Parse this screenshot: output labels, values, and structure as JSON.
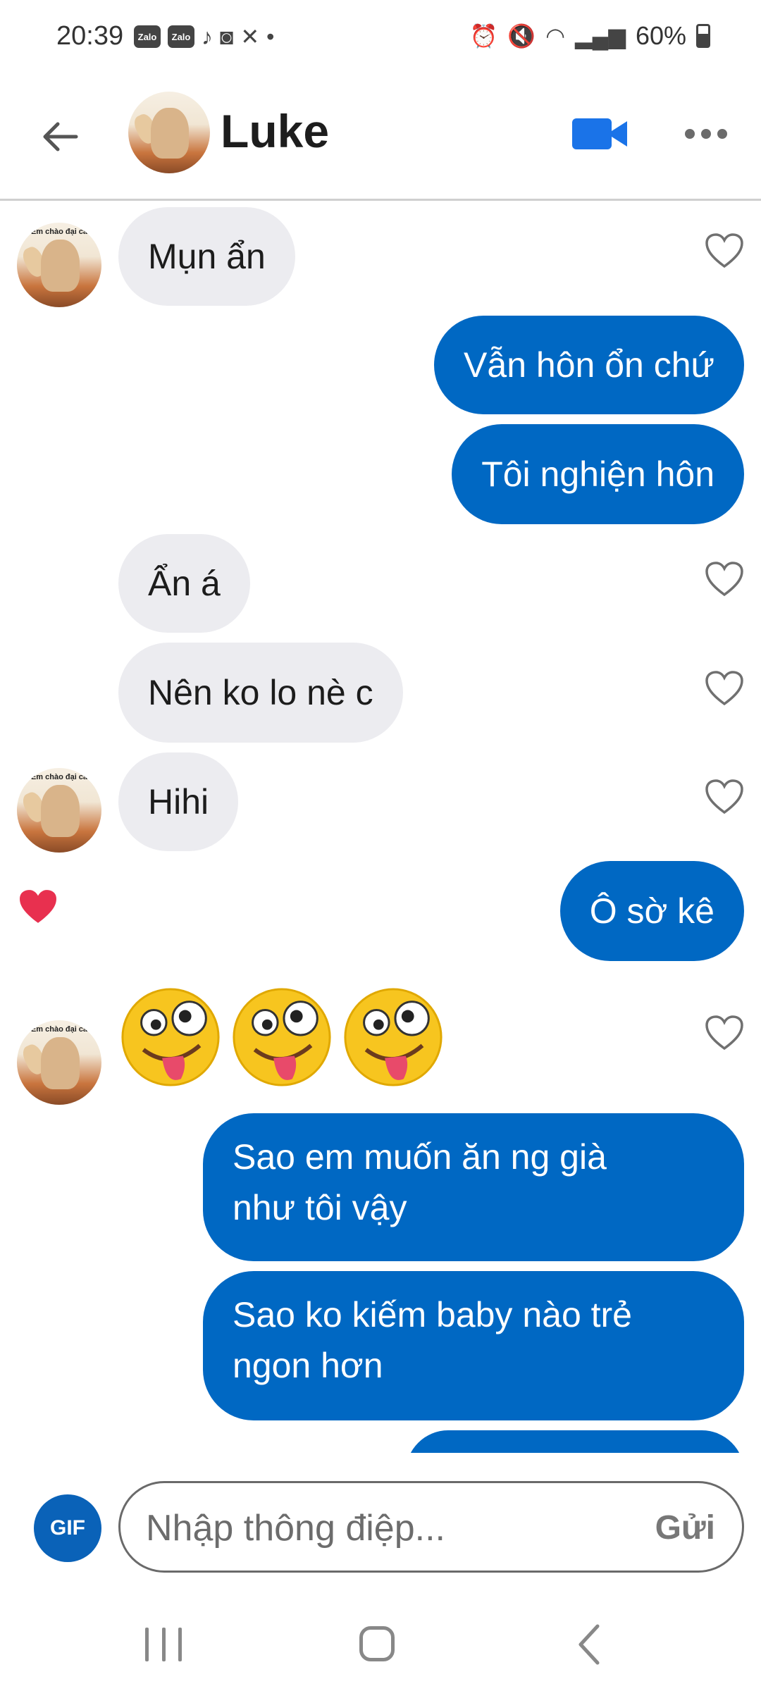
{
  "status_bar": {
    "time": "20:39",
    "app_icons": [
      "Zalo",
      "Zalo"
    ],
    "battery": "60%"
  },
  "header": {
    "contact_name": "Luke",
    "avatar_caption": "Em chào đại ca"
  },
  "messages": [
    {
      "side": "in",
      "text": "Mụn ẩn"
    },
    {
      "side": "out",
      "text": "Vẫn hôn ổn chứ"
    },
    {
      "side": "out",
      "text": "Tôi nghiện hôn"
    },
    {
      "side": "in",
      "text": "Ẩn á"
    },
    {
      "side": "in",
      "text": "Nên ko lo nè c"
    },
    {
      "side": "in",
      "text": "Hihi"
    },
    {
      "side": "out",
      "text": "Ô sờ kê",
      "liked": true
    },
    {
      "side": "in",
      "type": "emoji",
      "count": 3,
      "emoji": "zany-face"
    },
    {
      "side": "out",
      "line1": "Sao em muốn ăn ng già",
      "line2": "như tôi vậy"
    },
    {
      "side": "out",
      "line1": "Sao ko kiếm baby nào trẻ",
      "line2": "ngon hơn"
    }
  ],
  "composer": {
    "gif_label": "GIF",
    "placeholder": "Nhập thông điệp...",
    "send_label": "Gửi"
  },
  "colors": {
    "outgoing_bubble": "#0068c3",
    "incoming_bubble": "#ececf0",
    "like_heart": "#e8304f",
    "accent": "#1a73e8"
  }
}
